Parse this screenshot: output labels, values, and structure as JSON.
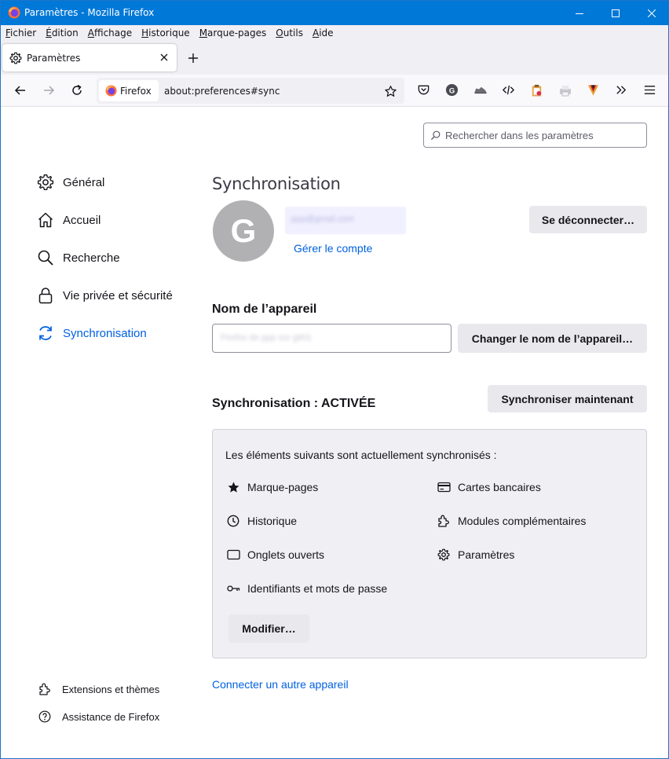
{
  "window": {
    "title": "Paramètres - Mozilla Firefox",
    "accent": "#0078d7"
  },
  "menubar": [
    "Fichier",
    "Édition",
    "Affichage",
    "Historique",
    "Marque-pages",
    "Outils",
    "Aide"
  ],
  "tab": {
    "label": "Paramètres"
  },
  "navbar": {
    "identity": "Firefox",
    "url": "about:preferences#sync"
  },
  "search": {
    "placeholder": "Rechercher dans les paramètres"
  },
  "sidebar": {
    "items": [
      {
        "label": "Général",
        "icon": "gear-icon"
      },
      {
        "label": "Accueil",
        "icon": "home-icon"
      },
      {
        "label": "Recherche",
        "icon": "search-icon"
      },
      {
        "label": "Vie privée et sécurité",
        "icon": "lock-icon"
      },
      {
        "label": "Synchronisation",
        "icon": "sync-icon",
        "active": true
      }
    ],
    "footer": [
      {
        "label": "Extensions et thèmes",
        "icon": "puzzle-icon"
      },
      {
        "label": "Assistance de Firefox",
        "icon": "help-icon"
      }
    ]
  },
  "sync": {
    "title": "Synchronisation",
    "avatar_letter": "G",
    "email": "ppp@gmail.com",
    "manage_account": "Gérer le compte",
    "disconnect": "Se déconnecter…",
    "device_heading": "Nom de l’appareil",
    "device_name": "Firefox de ppp sur gtt01",
    "rename_device": "Changer le nom de l’appareil…",
    "status": "Synchronisation : ACTIVÉE",
    "sync_now": "Synchroniser maintenant",
    "intro": "Les éléments suivants sont actuellement synchronisés :",
    "engines_left": [
      "Marque-pages",
      "Historique",
      "Onglets ouverts",
      "Identifiants et mots de passe"
    ],
    "engines_right": [
      "Cartes bancaires",
      "Modules complémentaires",
      "Paramètres"
    ],
    "modify": "Modifier…",
    "connect_other": "Connecter un autre appareil"
  }
}
